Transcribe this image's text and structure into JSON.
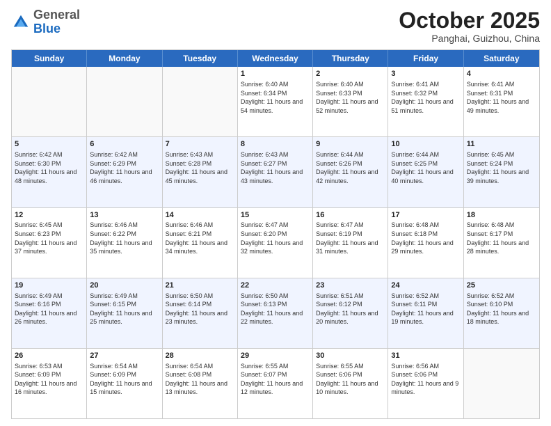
{
  "logo": {
    "general": "General",
    "blue": "Blue"
  },
  "header": {
    "month": "October 2025",
    "location": "Panghai, Guizhou, China"
  },
  "weekdays": [
    "Sunday",
    "Monday",
    "Tuesday",
    "Wednesday",
    "Thursday",
    "Friday",
    "Saturday"
  ],
  "weeks": [
    [
      {
        "day": "",
        "sunrise": "",
        "sunset": "",
        "daylight": ""
      },
      {
        "day": "",
        "sunrise": "",
        "sunset": "",
        "daylight": ""
      },
      {
        "day": "",
        "sunrise": "",
        "sunset": "",
        "daylight": ""
      },
      {
        "day": "1",
        "sunrise": "Sunrise: 6:40 AM",
        "sunset": "Sunset: 6:34 PM",
        "daylight": "Daylight: 11 hours and 54 minutes."
      },
      {
        "day": "2",
        "sunrise": "Sunrise: 6:40 AM",
        "sunset": "Sunset: 6:33 PM",
        "daylight": "Daylight: 11 hours and 52 minutes."
      },
      {
        "day": "3",
        "sunrise": "Sunrise: 6:41 AM",
        "sunset": "Sunset: 6:32 PM",
        "daylight": "Daylight: 11 hours and 51 minutes."
      },
      {
        "day": "4",
        "sunrise": "Sunrise: 6:41 AM",
        "sunset": "Sunset: 6:31 PM",
        "daylight": "Daylight: 11 hours and 49 minutes."
      }
    ],
    [
      {
        "day": "5",
        "sunrise": "Sunrise: 6:42 AM",
        "sunset": "Sunset: 6:30 PM",
        "daylight": "Daylight: 11 hours and 48 minutes."
      },
      {
        "day": "6",
        "sunrise": "Sunrise: 6:42 AM",
        "sunset": "Sunset: 6:29 PM",
        "daylight": "Daylight: 11 hours and 46 minutes."
      },
      {
        "day": "7",
        "sunrise": "Sunrise: 6:43 AM",
        "sunset": "Sunset: 6:28 PM",
        "daylight": "Daylight: 11 hours and 45 minutes."
      },
      {
        "day": "8",
        "sunrise": "Sunrise: 6:43 AM",
        "sunset": "Sunset: 6:27 PM",
        "daylight": "Daylight: 11 hours and 43 minutes."
      },
      {
        "day": "9",
        "sunrise": "Sunrise: 6:44 AM",
        "sunset": "Sunset: 6:26 PM",
        "daylight": "Daylight: 11 hours and 42 minutes."
      },
      {
        "day": "10",
        "sunrise": "Sunrise: 6:44 AM",
        "sunset": "Sunset: 6:25 PM",
        "daylight": "Daylight: 11 hours and 40 minutes."
      },
      {
        "day": "11",
        "sunrise": "Sunrise: 6:45 AM",
        "sunset": "Sunset: 6:24 PM",
        "daylight": "Daylight: 11 hours and 39 minutes."
      }
    ],
    [
      {
        "day": "12",
        "sunrise": "Sunrise: 6:45 AM",
        "sunset": "Sunset: 6:23 PM",
        "daylight": "Daylight: 11 hours and 37 minutes."
      },
      {
        "day": "13",
        "sunrise": "Sunrise: 6:46 AM",
        "sunset": "Sunset: 6:22 PM",
        "daylight": "Daylight: 11 hours and 35 minutes."
      },
      {
        "day": "14",
        "sunrise": "Sunrise: 6:46 AM",
        "sunset": "Sunset: 6:21 PM",
        "daylight": "Daylight: 11 hours and 34 minutes."
      },
      {
        "day": "15",
        "sunrise": "Sunrise: 6:47 AM",
        "sunset": "Sunset: 6:20 PM",
        "daylight": "Daylight: 11 hours and 32 minutes."
      },
      {
        "day": "16",
        "sunrise": "Sunrise: 6:47 AM",
        "sunset": "Sunset: 6:19 PM",
        "daylight": "Daylight: 11 hours and 31 minutes."
      },
      {
        "day": "17",
        "sunrise": "Sunrise: 6:48 AM",
        "sunset": "Sunset: 6:18 PM",
        "daylight": "Daylight: 11 hours and 29 minutes."
      },
      {
        "day": "18",
        "sunrise": "Sunrise: 6:48 AM",
        "sunset": "Sunset: 6:17 PM",
        "daylight": "Daylight: 11 hours and 28 minutes."
      }
    ],
    [
      {
        "day": "19",
        "sunrise": "Sunrise: 6:49 AM",
        "sunset": "Sunset: 6:16 PM",
        "daylight": "Daylight: 11 hours and 26 minutes."
      },
      {
        "day": "20",
        "sunrise": "Sunrise: 6:49 AM",
        "sunset": "Sunset: 6:15 PM",
        "daylight": "Daylight: 11 hours and 25 minutes."
      },
      {
        "day": "21",
        "sunrise": "Sunrise: 6:50 AM",
        "sunset": "Sunset: 6:14 PM",
        "daylight": "Daylight: 11 hours and 23 minutes."
      },
      {
        "day": "22",
        "sunrise": "Sunrise: 6:50 AM",
        "sunset": "Sunset: 6:13 PM",
        "daylight": "Daylight: 11 hours and 22 minutes."
      },
      {
        "day": "23",
        "sunrise": "Sunrise: 6:51 AM",
        "sunset": "Sunset: 6:12 PM",
        "daylight": "Daylight: 11 hours and 20 minutes."
      },
      {
        "day": "24",
        "sunrise": "Sunrise: 6:52 AM",
        "sunset": "Sunset: 6:11 PM",
        "daylight": "Daylight: 11 hours and 19 minutes."
      },
      {
        "day": "25",
        "sunrise": "Sunrise: 6:52 AM",
        "sunset": "Sunset: 6:10 PM",
        "daylight": "Daylight: 11 hours and 18 minutes."
      }
    ],
    [
      {
        "day": "26",
        "sunrise": "Sunrise: 6:53 AM",
        "sunset": "Sunset: 6:09 PM",
        "daylight": "Daylight: 11 hours and 16 minutes."
      },
      {
        "day": "27",
        "sunrise": "Sunrise: 6:54 AM",
        "sunset": "Sunset: 6:09 PM",
        "daylight": "Daylight: 11 hours and 15 minutes."
      },
      {
        "day": "28",
        "sunrise": "Sunrise: 6:54 AM",
        "sunset": "Sunset: 6:08 PM",
        "daylight": "Daylight: 11 hours and 13 minutes."
      },
      {
        "day": "29",
        "sunrise": "Sunrise: 6:55 AM",
        "sunset": "Sunset: 6:07 PM",
        "daylight": "Daylight: 11 hours and 12 minutes."
      },
      {
        "day": "30",
        "sunrise": "Sunrise: 6:55 AM",
        "sunset": "Sunset: 6:06 PM",
        "daylight": "Daylight: 11 hours and 10 minutes."
      },
      {
        "day": "31",
        "sunrise": "Sunrise: 6:56 AM",
        "sunset": "Sunset: 6:06 PM",
        "daylight": "Daylight: 11 hours and 9 minutes."
      },
      {
        "day": "",
        "sunrise": "",
        "sunset": "",
        "daylight": ""
      }
    ]
  ]
}
